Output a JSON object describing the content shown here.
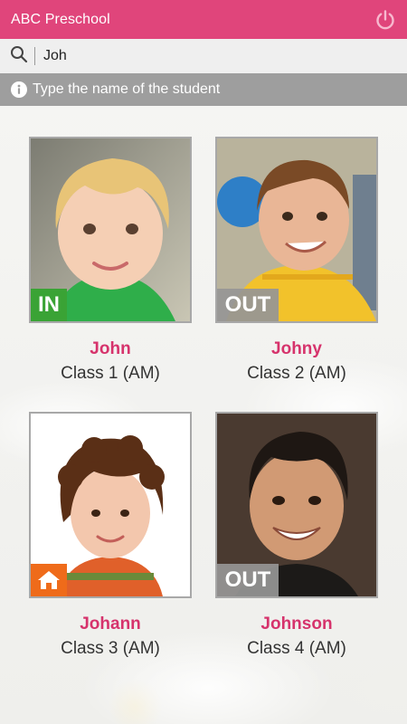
{
  "header": {
    "title": "ABC Preschool",
    "power_icon": "power-icon"
  },
  "search": {
    "value": "Joh",
    "icon": "search-icon"
  },
  "hint": {
    "text": "Type the name of the student",
    "icon": "info-icon"
  },
  "students": [
    {
      "name": "John",
      "class": "Class 1 (AM)",
      "status": "IN"
    },
    {
      "name": "Johny",
      "class": "Class 2 (AM)",
      "status": "OUT"
    },
    {
      "name": "Johann",
      "class": "Class 3 (AM)",
      "status": "home-icon"
    },
    {
      "name": "Johnson",
      "class": "Class 4 (AM)",
      "status": "OUT"
    }
  ],
  "colors": {
    "brand": "#e0457b",
    "name_text": "#d6336c",
    "status_in": "#3aa335",
    "status_out": "#969696",
    "status_home": "#ef6b1a"
  }
}
